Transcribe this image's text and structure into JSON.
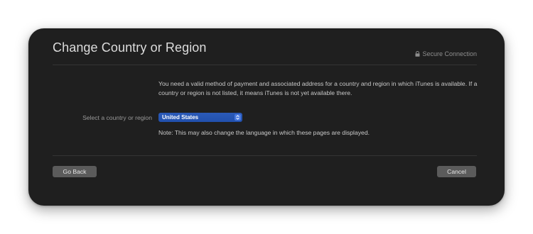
{
  "dialog": {
    "title": "Change Country or Region",
    "secure_label": "Secure Connection",
    "message": "You need a valid method of payment and associated address for a country and region in which iTunes is available. If a country or region is not listed, it means iTunes is not yet available there.",
    "select_label": "Select a country or region",
    "selected_country": "United States",
    "note": "Note: This may also change the language in which these pages are displayed.",
    "go_back_label": "Go Back",
    "cancel_label": "Cancel"
  },
  "colors": {
    "dialog_background": "#1f1f1f",
    "select_accent": "#2150ad",
    "button_background": "#5b5b5b"
  },
  "icons": {
    "secure": "lock-icon",
    "select": "chevron-updown-icon"
  }
}
